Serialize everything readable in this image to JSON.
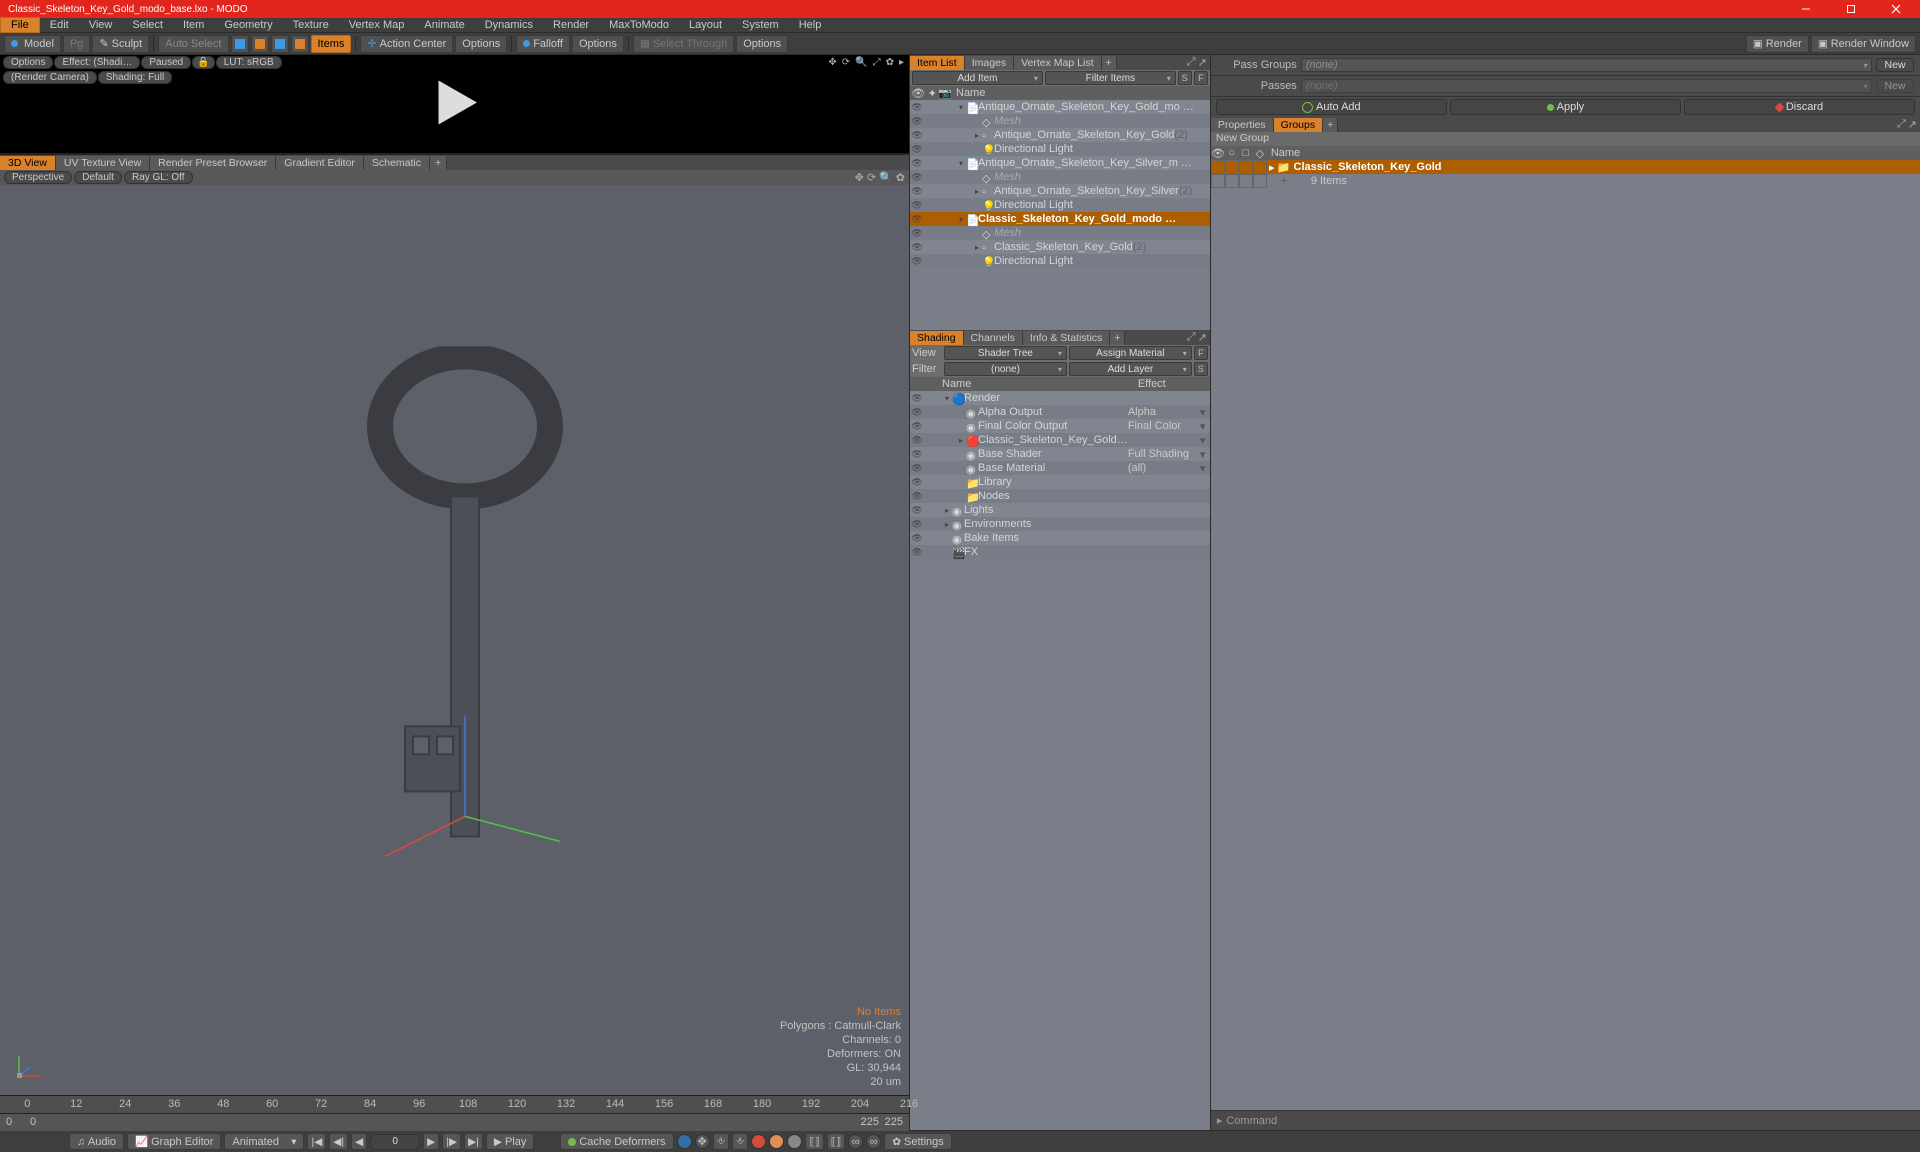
{
  "window": {
    "title": "Classic_Skeleton_Key_Gold_modo_base.lxo - MODO"
  },
  "menu": [
    "File",
    "Edit",
    "View",
    "Select",
    "Item",
    "Geometry",
    "Texture",
    "Vertex Map",
    "Animate",
    "Dynamics",
    "Render",
    "MaxToModo",
    "Layout",
    "System",
    "Help"
  ],
  "toolbar": {
    "model": "Model",
    "pg": "Pg",
    "sculpt": "Sculpt",
    "autoselect": "Auto Select",
    "items": "Items",
    "actioncenter": "Action Center",
    "options1": "Options",
    "falloff": "Falloff",
    "options2": "Options",
    "selectthrough": "Select Through",
    "options3": "Options",
    "render": "Render",
    "renderwindow": "Render Window"
  },
  "preview": {
    "options": "Options",
    "effect": "Effect: (Shadi…",
    "paused": "Paused",
    "lut": "LUT: sRGB",
    "rendercam": "(Render Camera)",
    "shading": "Shading: Full"
  },
  "viewtabs": [
    "3D View",
    "UV Texture View",
    "Render Preset Browser",
    "Gradient Editor",
    "Schematic"
  ],
  "viewbar": {
    "perspective": "Perspective",
    "default": "Default",
    "raygl": "Ray GL: Off"
  },
  "hud": {
    "noitems": "No Items",
    "polys": "Polygons : Catmull-Clark",
    "channels": "Channels: 0",
    "deformers": "Deformers: ON",
    "gl": "GL: 30,944",
    "dist": "20 um"
  },
  "timeline": {
    "ticks": [
      0,
      12,
      24,
      36,
      48,
      60,
      72,
      84,
      96,
      108,
      120,
      132,
      144,
      156,
      168,
      180,
      192,
      204,
      216
    ],
    "range_a": "0",
    "range_b": "225",
    "range_c": "0",
    "range_d": "225"
  },
  "bottom": {
    "audio": "Audio",
    "grapheditor": "Graph Editor",
    "animated": "Animated",
    "frame": "0",
    "play": "Play",
    "cachedeformers": "Cache Deformers",
    "settings": "Settings"
  },
  "itemlist": {
    "tabs": [
      "Item List",
      "Images",
      "Vertex Map List"
    ],
    "additem": "Add Item",
    "filter": "Filter Items",
    "namecol": "Name",
    "s": "S",
    "f": "F",
    "items": [
      {
        "depth": 0,
        "tw": "▾",
        "icon": "scene",
        "label": "Antique_Ornate_Skeleton_Key_Gold_mo …"
      },
      {
        "depth": 1,
        "tw": "",
        "icon": "mesh",
        "label": "Mesh",
        "italic": true
      },
      {
        "depth": 1,
        "tw": "▸",
        "icon": "loc",
        "label": "Antique_Ornate_Skeleton_Key_Gold",
        "suffix": "(2)"
      },
      {
        "depth": 1,
        "tw": "",
        "icon": "light",
        "label": "Directional Light"
      },
      {
        "depth": 0,
        "tw": "▾",
        "icon": "scene",
        "label": "Antique_Ornate_Skeleton_Key_Silver_m …"
      },
      {
        "depth": 1,
        "tw": "",
        "icon": "mesh",
        "label": "Mesh",
        "italic": true
      },
      {
        "depth": 1,
        "tw": "▸",
        "icon": "loc",
        "label": "Antique_Ornate_Skeleton_Key_Silver",
        "suffix": "(2)"
      },
      {
        "depth": 1,
        "tw": "",
        "icon": "light",
        "label": "Directional Light"
      },
      {
        "depth": 0,
        "tw": "▾",
        "icon": "scene",
        "label": "Classic_Skeleton_Key_Gold_modo …",
        "selected": true
      },
      {
        "depth": 1,
        "tw": "",
        "icon": "mesh",
        "label": "Mesh",
        "italic": true
      },
      {
        "depth": 1,
        "tw": "▸",
        "icon": "loc",
        "label": "Classic_Skeleton_Key_Gold",
        "suffix": "(2)"
      },
      {
        "depth": 1,
        "tw": "",
        "icon": "light",
        "label": "Directional Light"
      }
    ]
  },
  "shading": {
    "tabs": [
      "Shading",
      "Channels",
      "Info & Statistics"
    ],
    "viewlbl": "View",
    "viewval": "Shader Tree",
    "assign": "Assign Material",
    "f": "F",
    "filterlbl": "Filter",
    "filterval": "(none)",
    "addlayer": "Add Layer",
    "s": "S",
    "namecol": "Name",
    "effectcol": "Effect",
    "rows": [
      {
        "depth": 0,
        "tw": "▾",
        "icon": "render",
        "label": "Render",
        "effect": ""
      },
      {
        "depth": 1,
        "tw": "",
        "icon": "alpha",
        "label": "Alpha Output",
        "effect": "Alpha",
        "dd": true
      },
      {
        "depth": 1,
        "tw": "",
        "icon": "final",
        "label": "Final Color Output",
        "effect": "Final Color",
        "dd": true
      },
      {
        "depth": 1,
        "tw": "▸",
        "icon": "mat",
        "label": "Classic_Skeleton_Key_Gold…",
        "effect": "",
        "dd": true
      },
      {
        "depth": 1,
        "tw": "",
        "icon": "shader",
        "label": "Base Shader",
        "effect": "Full Shading",
        "dd": true
      },
      {
        "depth": 1,
        "tw": "",
        "icon": "matb",
        "label": "Base Material",
        "effect": "(all)",
        "dd": true
      },
      {
        "depth": 1,
        "tw": "",
        "icon": "folder",
        "label": "Library",
        "effect": ""
      },
      {
        "depth": 1,
        "tw": "",
        "icon": "folder",
        "label": "Nodes",
        "effect": ""
      },
      {
        "depth": 0,
        "tw": "▸",
        "icon": "",
        "label": "Lights",
        "effect": ""
      },
      {
        "depth": 0,
        "tw": "▸",
        "icon": "",
        "label": "Environments",
        "effect": ""
      },
      {
        "depth": 0,
        "tw": "",
        "icon": "",
        "label": "Bake Items",
        "effect": ""
      },
      {
        "depth": 0,
        "tw": "",
        "icon": "fx",
        "label": "FX",
        "effect": ""
      }
    ]
  },
  "passes": {
    "passgroups": "Pass Groups",
    "none": "(none)",
    "new": "New",
    "passes_lbl": "Passes",
    "autoadd": "Auto Add",
    "apply": "Apply",
    "discard": "Discard"
  },
  "props": {
    "tabs": [
      "Properties",
      "Groups"
    ],
    "newgroup": "New Group",
    "namecol": "Name",
    "row": {
      "label": "Classic_Skeleton_Key_Gold",
      "count": "9 Items"
    }
  },
  "command": "Command"
}
